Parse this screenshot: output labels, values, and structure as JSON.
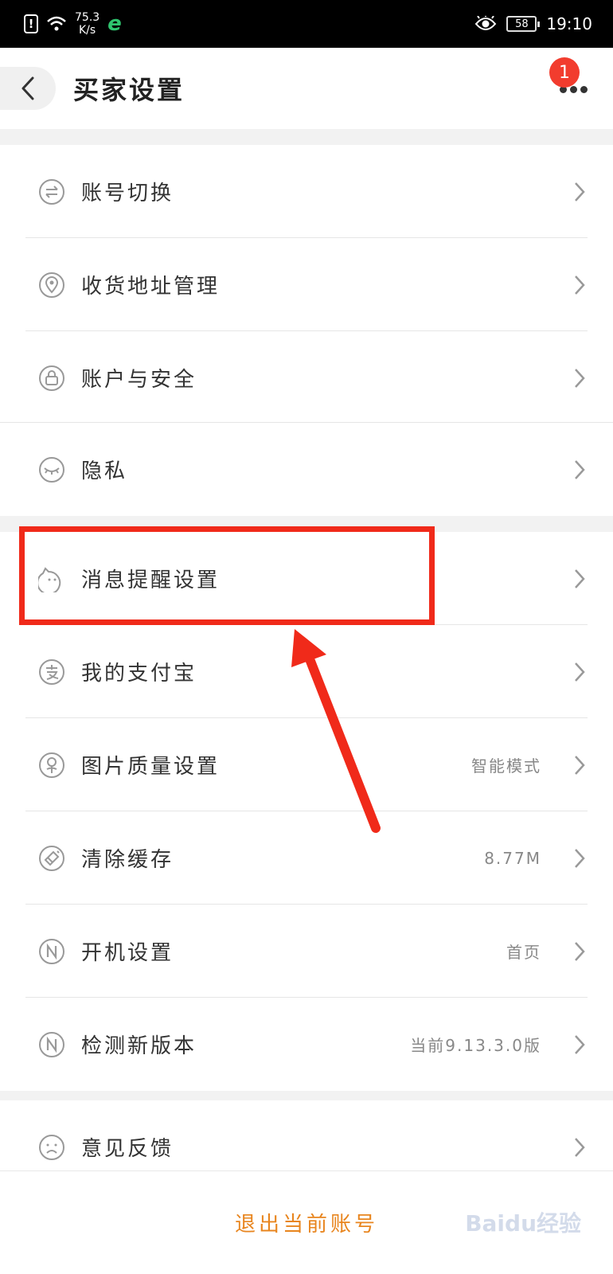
{
  "status_bar": {
    "alert_symbol": "!",
    "speed_value": "75.3",
    "speed_unit": "K/s",
    "browser_letter": "e",
    "battery": "58",
    "time": "19:10"
  },
  "header": {
    "title": "买家设置",
    "badge_count": "1"
  },
  "groups": {
    "g1": [
      {
        "label": "账号切换",
        "icon": "swap-icon"
      },
      {
        "label": "收货地址管理",
        "icon": "location-icon"
      },
      {
        "label": "账户与安全",
        "icon": "lock-icon"
      }
    ],
    "g2": [
      {
        "label": "隐私",
        "icon": "eye-closed-icon"
      }
    ],
    "g3": [
      {
        "label": "消息提醒设置",
        "icon": "message-cat-icon"
      },
      {
        "label": "我的支付宝",
        "icon": "alipay-icon"
      },
      {
        "label": "图片质量设置",
        "icon": "image-quality-icon",
        "value": "智能模式"
      },
      {
        "label": "清除缓存",
        "icon": "clear-cache-icon",
        "value": "8.77M"
      },
      {
        "label": "开机设置",
        "icon": "startup-icon",
        "value": "首页"
      },
      {
        "label": "检测新版本",
        "icon": "version-icon",
        "value": "当前9.13.3.0版"
      }
    ],
    "g4": [
      {
        "label": "意见反馈",
        "icon": "feedback-icon"
      }
    ]
  },
  "logout_label": "退出当前账号",
  "watermark": "Baidu经验",
  "colors": {
    "accent": "#e8851e",
    "badge": "#f23c2e",
    "annotation": "#f02a1a"
  }
}
